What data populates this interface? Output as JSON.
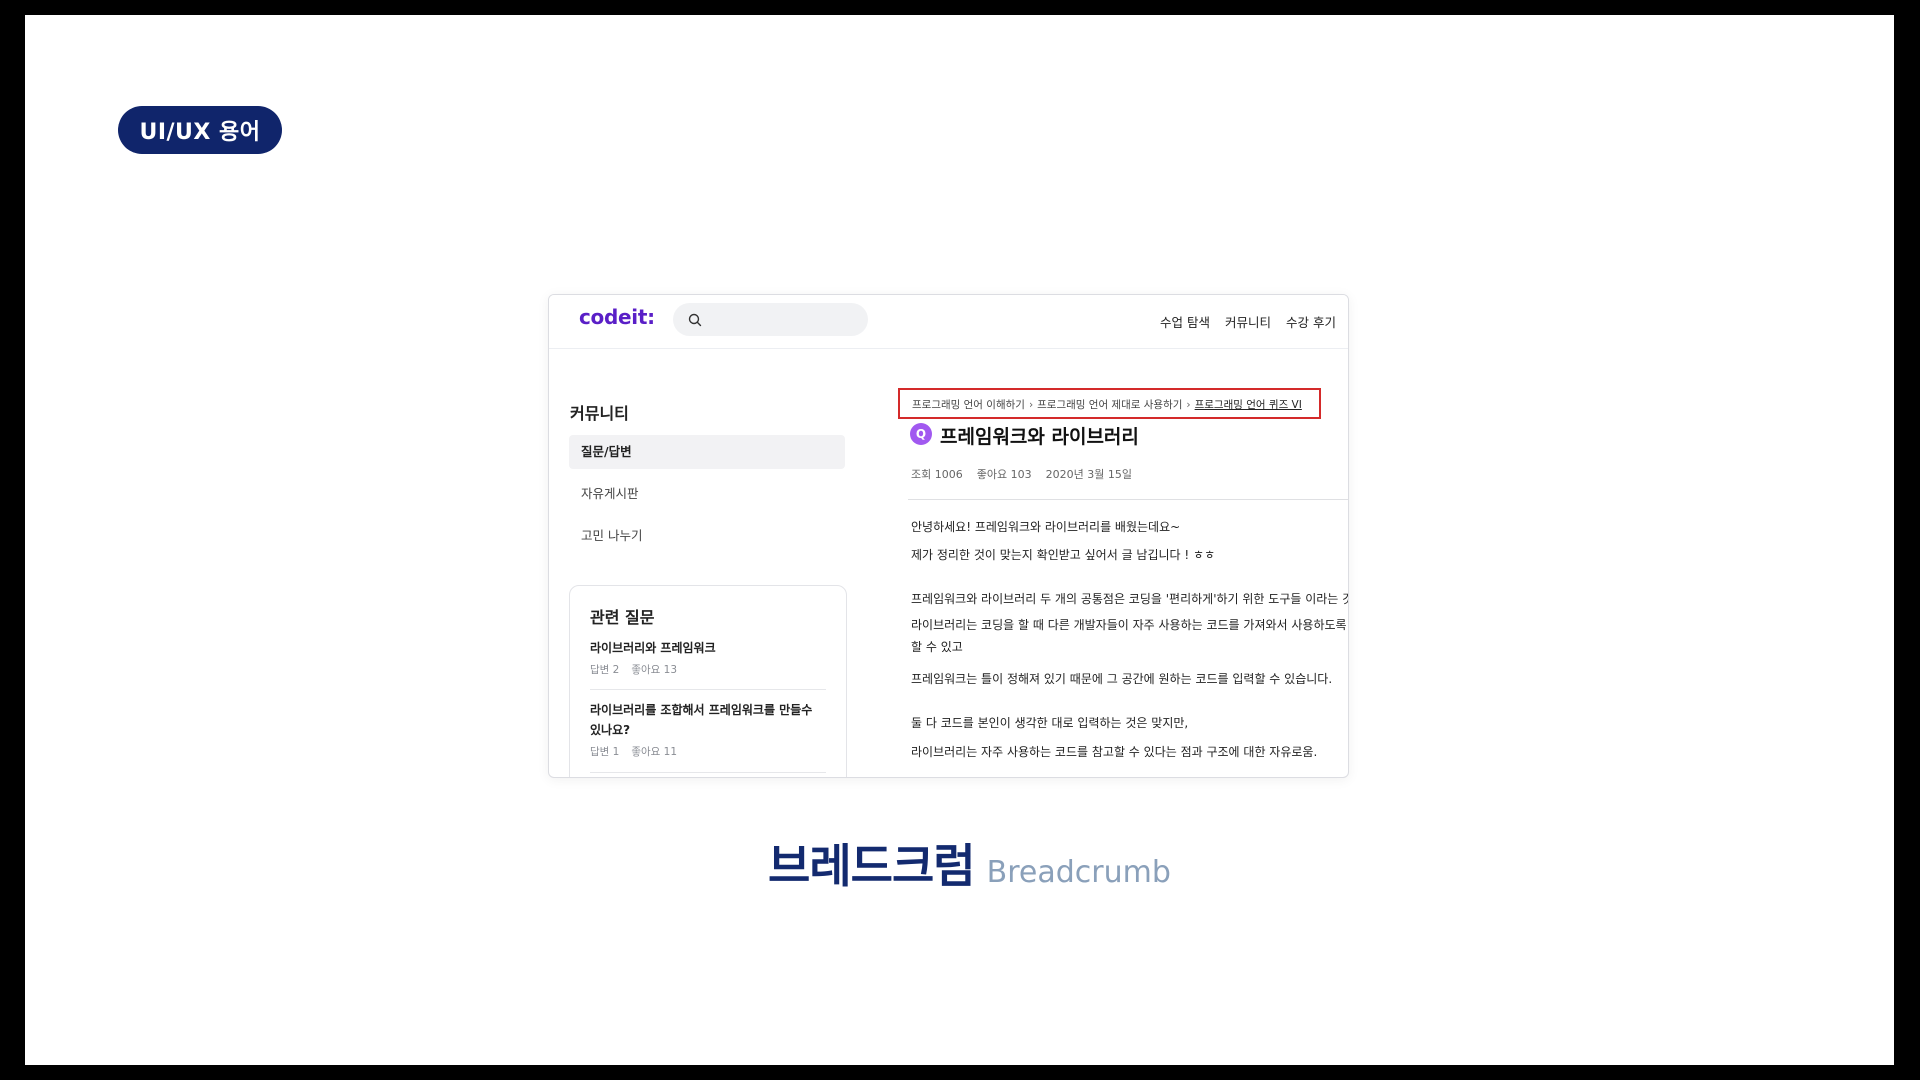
{
  "slide": {
    "tag": "UI/UX 용어",
    "caption_ko": "브레드크럼",
    "caption_en": "Breadcrumb"
  },
  "site": {
    "logo": "codeit",
    "logo_suffix": ":",
    "search": {
      "placeholder": "",
      "value": ""
    },
    "nav": [
      "수업 탐색",
      "커뮤니티",
      "수강 후기"
    ]
  },
  "sidebar": {
    "title": "커뮤니티",
    "items": [
      {
        "label": "질문/답변",
        "active": true
      },
      {
        "label": "자유게시판",
        "active": false
      },
      {
        "label": "고민 나누기",
        "active": false
      }
    ]
  },
  "related": {
    "title": "관련 질문",
    "items": [
      {
        "question": "라이브러리와 프레임워크",
        "answers": "답변 2",
        "likes": "좋아요 13"
      },
      {
        "question": "라이브러리를 조합해서 프레임워크를 만들수 있나요?",
        "answers": "답변 1",
        "likes": "좋아요 11"
      }
    ]
  },
  "breadcrumb": {
    "items": [
      "프로그래밍 언어 이해하기",
      "프로그래밍 언어 제대로 사용하기",
      "프로그래밍 언어 퀴즈 VI"
    ],
    "separator": "›"
  },
  "post": {
    "badge": "Q",
    "title": "프레임워크와 라이브러리",
    "views": "조회 1006",
    "likes": "좋아요 103",
    "date": "2020년 3월 15일",
    "paragraphs": [
      "안녕하세요! 프레임워크와 라이브러리를 배웠는데요~",
      "제가 정리한 것이 맞는지 확인받고 싶어서 글 남깁니다 ! ㅎㅎ",
      "프레임워크와 라이브러리 두 개의 공통점은 코딩을 '편리하게'하기 위한 도구들 이라는 것이고",
      "라이브러리는 코딩을 할 때 다른 개발자들이 자주 사용하는 코드를 가져와서 사용하도록 할 수 있고",
      "프레임워크는 틀이 정해져 있기 때문에 그 공간에 원하는 코드를 입력할 수 있습니다.",
      "둘 다 코드를 본인이 생각한 대로 입력하는 것은 맞지만,",
      "라이브러리는 자주 사용하는 코드를 참고할 수 있다는 점과 구조에 대한 자유로움."
    ]
  },
  "colors": {
    "tag_bg": "#10256b",
    "logo": "#5a1fc7",
    "highlight_border": "#d42a2a",
    "badge": "#a159f0",
    "caption_ko": "#132a6f",
    "caption_en": "#8aa0ba"
  }
}
